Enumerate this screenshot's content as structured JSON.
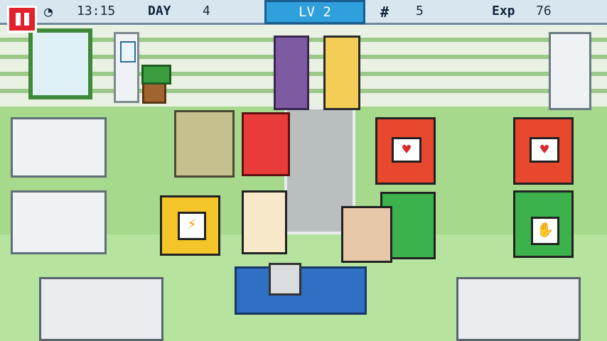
{
  "hud": {
    "time": "13:15",
    "day_label": "DAY",
    "day_value": "4",
    "level": "LV 2",
    "money_value": "5",
    "exp_label": "Exp",
    "exp_value": "76"
  },
  "colors": {
    "hud_bg": "#d8e6ef",
    "pause_red": "#e4202a",
    "level_blue": "#2fa0db",
    "floor_green": "#a6d98c"
  },
  "icons": {
    "clock": "clock-icon",
    "money": "hash-money-icon",
    "pause": "pause-icon"
  }
}
